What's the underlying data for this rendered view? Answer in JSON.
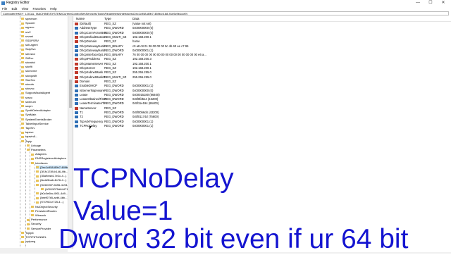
{
  "window": {
    "title": "Registry Editor",
    "icon": "registry-icon",
    "controls": [
      "—",
      "☐",
      "✕"
    ]
  },
  "menu": [
    "File",
    "Edit",
    "View",
    "Favorites",
    "Help"
  ],
  "address": "Computer\\HKEY_LOCAL_MACHINE\\SYSTEM\\CurrentControlSet\\Services\\Tcpip\\Parameters\\Interfaces\\{2ec1c958-89b7-489b-b168-91e5c9b1ccf9}",
  "tree": {
    "items": [
      "spectrum",
      "Spooler",
      "sppsvc",
      "srv2",
      "srvnet",
      "SSDPSRV",
      "ssh-agent",
      "SstpSvc",
      "stexstor",
      "StiSvc",
      "storahci",
      "storflt",
      "stornvme",
      "storqosflt",
      "StorSvc",
      "storufs",
      "storvsc",
      "SupportAssistAgent",
      "svsvc",
      "swenum",
      "swprv",
      "SynthDetectAdapter",
      "SysMain",
      "SystemEventsBroker",
      "TabletInputService",
      "TapiSrv",
      "tapsvc",
      "tapwin8...",
      "Tcpip",
      "Linkage",
      "Parameters",
      "Adapters",
      "DNSRegisteredAdapters",
      "Interfaces",
      "{2ec1c958-89b7-489b-...}",
      "{3f1fc1789-b146-4fb...}",
      "{35a9eab4-7e2c-4...}",
      "{8cdd9ba6-4b76-4...}",
      "{9e3203f7-5b96-4194-...}",
      "{40015075d64471...}",
      "{b0c0e6bc-0f61-4d9...}",
      "{beef07b5-aebf-4bb...}",
      "{f727f60-e725-4...}",
      "NsiObjectSecurity",
      "PersistentRoutes",
      "Winsock",
      "Performance",
      "Security",
      "ServiceProvider",
      "Tcpip6",
      "TCPIP6TUNNEL",
      "tcpipreg"
    ]
  },
  "list": {
    "columns": {
      "name": "Name",
      "type": "Type",
      "data": "Data"
    },
    "rows": [
      {
        "icon": "ab",
        "name": "(Default)",
        "type": "REG_SZ",
        "data": "(value not set)"
      },
      {
        "icon": "bin",
        "name": "AddressType",
        "type": "REG_DWORD",
        "data": "0x00000000 (0)"
      },
      {
        "icon": "bin",
        "name": "DhcpConnForceBro...",
        "type": "REG_DWORD",
        "data": "0x00000000 (0)"
      },
      {
        "icon": "ab",
        "name": "DhcpDefaultGatew...",
        "type": "REG_MULTI_SZ",
        "data": "192.168.200.1"
      },
      {
        "icon": "ab",
        "name": "DhcpDomain",
        "type": "REG_SZ",
        "data": "home"
      },
      {
        "icon": "bin",
        "name": "DhcpGatewayHard...",
        "type": "REG_BINARY",
        "data": "c0 a8 c8 01 06 00 00 00 5c 4b 60 ee c7 95"
      },
      {
        "icon": "bin",
        "name": "DhcpGatewayHard...",
        "type": "REG_DWORD",
        "data": "0x00000001 (1)"
      },
      {
        "icon": "bin",
        "name": "DhcpInterfaceOpt...",
        "type": "REG_BINARY",
        "data": "76 00 00 00 00 00 00 00 00 00 00 00 00 00 00 00 e6 a..."
      },
      {
        "icon": "ab",
        "name": "DhcpIPAddress",
        "type": "REG_SZ",
        "data": "192.168.200.3"
      },
      {
        "icon": "ab",
        "name": "DhcpNameServer",
        "type": "REG_SZ",
        "data": "192.168.200.1"
      },
      {
        "icon": "ab",
        "name": "DhcpServer",
        "type": "REG_SZ",
        "data": "192.168.200.1"
      },
      {
        "icon": "ab",
        "name": "DhcpSubnetMask",
        "type": "REG_SZ",
        "data": "255.255.255.0"
      },
      {
        "icon": "ab",
        "name": "DhcpSubnetMaskO...",
        "type": "REG_MULTI_SZ",
        "data": "255.255.255.0"
      },
      {
        "icon": "ab",
        "name": "Domain",
        "type": "REG_SZ",
        "data": ""
      },
      {
        "icon": "bin",
        "name": "EnableDHCP",
        "type": "REG_DWORD",
        "data": "0x00000001 (1)"
      },
      {
        "icon": "bin",
        "name": "IsServerNapAware",
        "type": "REG_DWORD",
        "data": "0x00000000 (0)"
      },
      {
        "icon": "bin",
        "name": "Lease",
        "type": "REG_DWORD",
        "data": "0x00015180 (86400)"
      },
      {
        "icon": "bin",
        "name": "LeaseObtainedTime",
        "type": "REG_DWORD",
        "data": "0x5f0fd514 (43200)"
      },
      {
        "icon": "bin",
        "name": "LeaseTerminatesTi...",
        "type": "REG_DWORD",
        "data": "0x5f11e194 (86400)"
      },
      {
        "icon": "ab",
        "name": "NameServer",
        "type": "REG_SZ",
        "data": ""
      },
      {
        "icon": "bin",
        "name": "T1",
        "type": "REG_DWORD",
        "data": "0x5f00b6d4 (43200)"
      },
      {
        "icon": "bin",
        "name": "T2",
        "type": "REG_DWORD",
        "data": "0x5f01174d (75600)"
      },
      {
        "icon": "bin",
        "name": "TcpAckFrequency",
        "type": "REG_DWORD",
        "data": "0x00000001 (1)"
      },
      {
        "icon": "bin",
        "name": "TCPNoDelay",
        "type": "REG_DWORD",
        "data": "0x00000001 (1)"
      }
    ]
  },
  "overlay": {
    "line1": "TCPNoDelay",
    "line2": "Value=1",
    "line3": "Dword 32 bit even if ur 64 bit",
    "color": "#1414d0"
  }
}
